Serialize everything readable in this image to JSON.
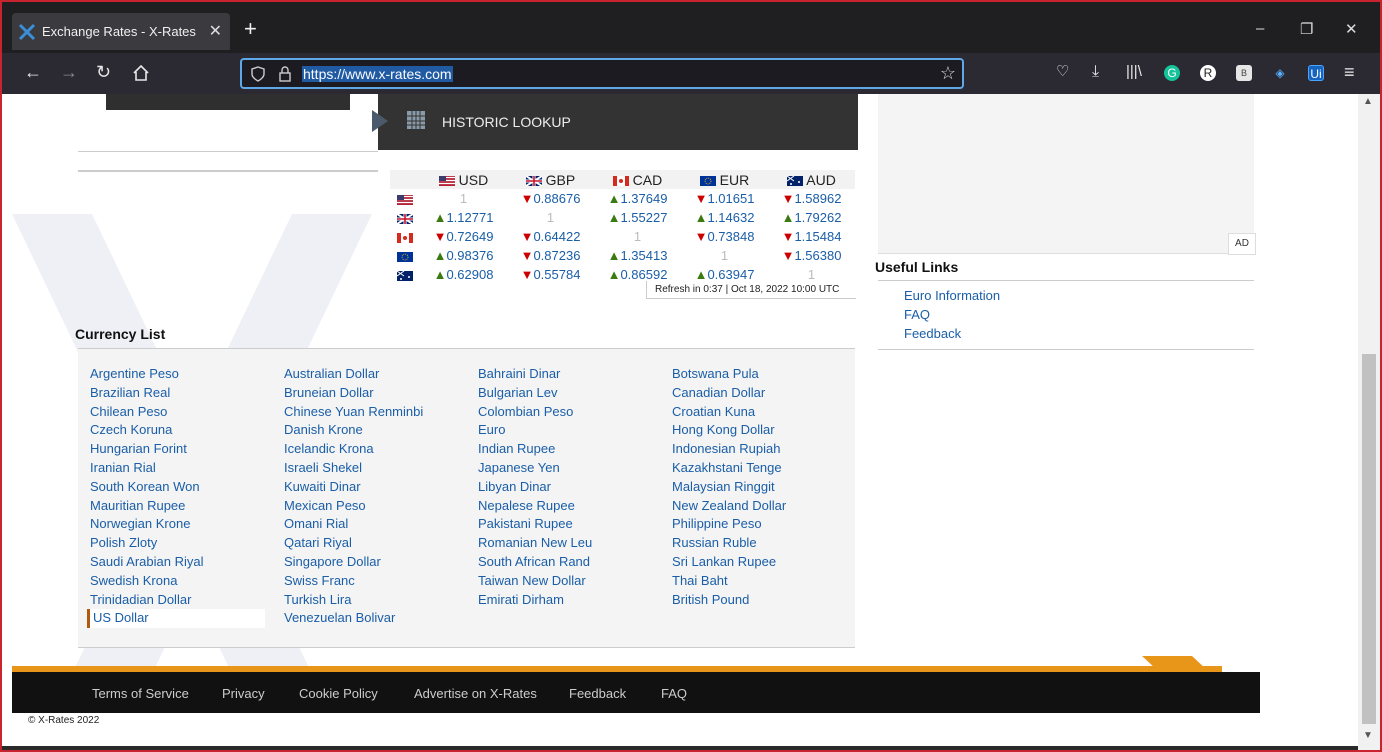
{
  "browser": {
    "tab_title": "Exchange Rates - X-Rates",
    "url": "https://www.x-rates.com",
    "window_controls": {
      "minimize": "–",
      "restore": "❐",
      "close": "✕"
    }
  },
  "page": {
    "historic_lookup": "HISTORIC LOOKUP",
    "rates_table": {
      "headers": [
        "USD",
        "GBP",
        "CAD",
        "EUR",
        "AUD"
      ],
      "rows": [
        {
          "flag": "usd",
          "cells": [
            {
              "v": "1",
              "t": "one"
            },
            {
              "v": "0.88676",
              "t": "down"
            },
            {
              "v": "1.37649",
              "t": "up"
            },
            {
              "v": "1.01651",
              "t": "down"
            },
            {
              "v": "1.58962",
              "t": "down"
            }
          ]
        },
        {
          "flag": "gbp",
          "cells": [
            {
              "v": "1.12771",
              "t": "up"
            },
            {
              "v": "1",
              "t": "one"
            },
            {
              "v": "1.55227",
              "t": "up"
            },
            {
              "v": "1.14632",
              "t": "up"
            },
            {
              "v": "1.79262",
              "t": "up"
            }
          ]
        },
        {
          "flag": "cad",
          "cells": [
            {
              "v": "0.72649",
              "t": "down"
            },
            {
              "v": "0.64422",
              "t": "down"
            },
            {
              "v": "1",
              "t": "one"
            },
            {
              "v": "0.73848",
              "t": "down"
            },
            {
              "v": "1.15484",
              "t": "down"
            }
          ]
        },
        {
          "flag": "eur",
          "cells": [
            {
              "v": "0.98376",
              "t": "up"
            },
            {
              "v": "0.87236",
              "t": "down"
            },
            {
              "v": "1.35413",
              "t": "up"
            },
            {
              "v": "1",
              "t": "one"
            },
            {
              "v": "1.56380",
              "t": "down"
            }
          ]
        },
        {
          "flag": "aud",
          "cells": [
            {
              "v": "0.62908",
              "t": "up"
            },
            {
              "v": "0.55784",
              "t": "down"
            },
            {
              "v": "0.86592",
              "t": "up"
            },
            {
              "v": "0.63947",
              "t": "up"
            },
            {
              "v": "1",
              "t": "one"
            }
          ]
        }
      ],
      "refresh": "Refresh in 0:37 | Oct 18, 2022 10:00 UTC"
    },
    "ad_label": "AD",
    "useful_links": {
      "title": "Useful Links",
      "items": [
        "Euro Information",
        "FAQ",
        "Feedback"
      ]
    },
    "currency_list": {
      "title": "Currency List",
      "columns": [
        [
          "Argentine Peso",
          "Brazilian Real",
          "Chilean Peso",
          "Czech Koruna",
          "Hungarian Forint",
          "Iranian Rial",
          "South Korean Won",
          "Mauritian Rupee",
          "Norwegian Krone",
          "Polish Zloty",
          "Saudi Arabian Riyal",
          "Swedish Krona",
          "Trinidadian Dollar",
          "US Dollar"
        ],
        [
          "Australian Dollar",
          "Bruneian Dollar",
          "Chinese Yuan Renminbi",
          "Danish Krone",
          "Icelandic Krona",
          "Israeli Shekel",
          "Kuwaiti Dinar",
          "Mexican Peso",
          "Omani Rial",
          "Qatari Riyal",
          "Singapore Dollar",
          "Swiss Franc",
          "Turkish Lira",
          "Venezuelan Bolivar"
        ],
        [
          "Bahraini Dinar",
          "Bulgarian Lev",
          "Colombian Peso",
          "Euro",
          "Indian Rupee",
          "Japanese Yen",
          "Libyan Dinar",
          "Nepalese Rupee",
          "Pakistani Rupee",
          "Romanian New Leu",
          "South African Rand",
          "Taiwan New Dollar",
          "Emirati Dirham"
        ],
        [
          "Botswana Pula",
          "Canadian Dollar",
          "Croatian Kuna",
          "Hong Kong Dollar",
          "Indonesian Rupiah",
          "Kazakhstani Tenge",
          "Malaysian Ringgit",
          "New Zealand Dollar",
          "Philippine Peso",
          "Russian Ruble",
          "Sri Lankan Rupee",
          "Thai Baht",
          "British Pound"
        ]
      ],
      "selected": "US Dollar"
    },
    "footer": {
      "links": [
        "Terms of Service",
        "Privacy",
        "Cookie Policy",
        "Advertise on X-Rates",
        "Feedback",
        "FAQ"
      ],
      "copyright": "© X-Rates 2022"
    },
    "colors": {
      "accent_orange": "#e8961a",
      "link_blue": "#1a5ea8",
      "up_green": "#3a7a10",
      "down_red": "#cc0000"
    }
  }
}
